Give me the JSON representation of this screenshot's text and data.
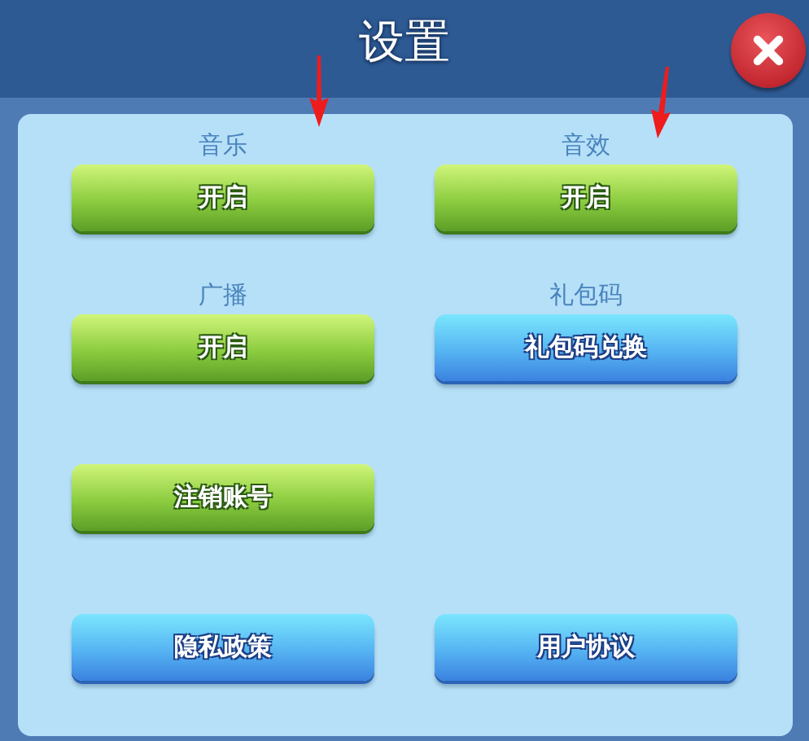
{
  "window": {
    "title": "设置"
  },
  "rows": [
    {
      "cells": [
        {
          "label": "音乐",
          "button": {
            "text": "开启",
            "kind": "green"
          }
        },
        {
          "label": "音效",
          "button": {
            "text": "开启",
            "kind": "green"
          }
        }
      ]
    },
    {
      "cells": [
        {
          "label": "广播",
          "button": {
            "text": "开启",
            "kind": "green"
          }
        },
        {
          "label": "礼包码",
          "button": {
            "text": "礼包码兑换",
            "kind": "blue"
          }
        }
      ]
    },
    {
      "cells": [
        {
          "button": {
            "text": "注销账号",
            "kind": "green"
          }
        }
      ]
    },
    {
      "cells": [
        {
          "button": {
            "text": "隐私政策",
            "kind": "blue"
          }
        },
        {
          "button": {
            "text": "用户协议",
            "kind": "blue"
          }
        }
      ]
    }
  ]
}
